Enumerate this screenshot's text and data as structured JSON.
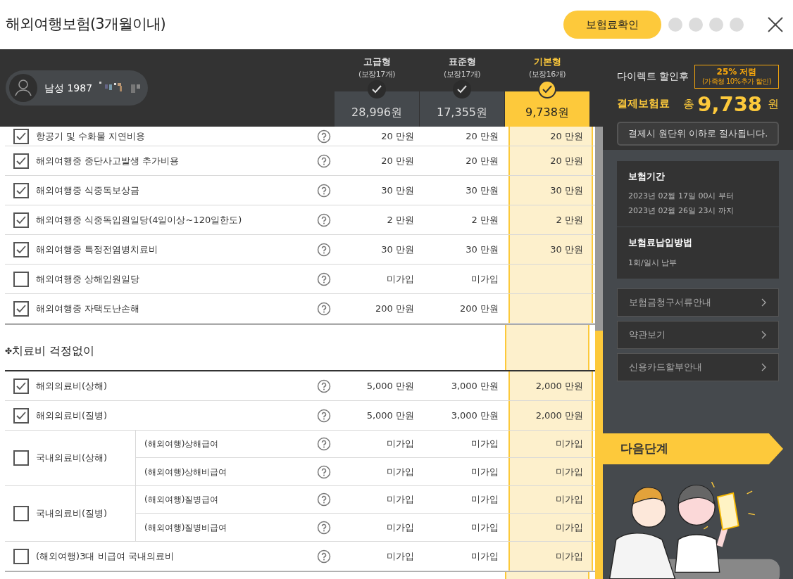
{
  "title": "해외여행보험(3개월이내)",
  "header_button": "보험료확인",
  "step_dots": [
    {
      "selected": false
    },
    {
      "selected": false
    },
    {
      "selected": false
    },
    {
      "selected": false
    }
  ],
  "user": {
    "label": "남성 1987"
  },
  "plans": [
    {
      "name": "고급형",
      "sub": "(보장17개)",
      "price": "28,996원",
      "selected": false
    },
    {
      "name": "표준형",
      "sub": "(보장17개)",
      "price": "17,355원",
      "selected": false
    },
    {
      "name": "기본형",
      "sub": "(보장16개)",
      "price": "9,738원",
      "selected": true
    }
  ],
  "rows_top": [
    {
      "kind": "single",
      "label": "항공기 및 수화물 지연비용",
      "checked": true,
      "values": [
        "20 만원",
        "20 만원",
        "20 만원"
      ]
    },
    {
      "kind": "single",
      "label": "해외여행중 중단사고발생 추가비용",
      "checked": true,
      "values": [
        "20 만원",
        "20 만원",
        "20 만원"
      ]
    },
    {
      "kind": "single",
      "label": "해외여행중 식중독보상금",
      "checked": true,
      "values": [
        "30 만원",
        "30 만원",
        "30 만원"
      ]
    },
    {
      "kind": "single",
      "label": "해외여행중 식중독입원일당(4일이상~120일한도)",
      "checked": true,
      "values": [
        "2 만원",
        "2 만원",
        "2 만원"
      ]
    },
    {
      "kind": "single",
      "label": "해외여행중 특정전염병치료비",
      "checked": true,
      "values": [
        "30 만원",
        "30 만원",
        "30 만원"
      ]
    },
    {
      "kind": "single",
      "label": "해외여행중 상해입원일당",
      "checked": false,
      "values": [
        "미가입",
        "미가입"
      ]
    },
    {
      "kind": "single",
      "label": "해외여행중 자택도난손해",
      "checked": true,
      "values": [
        "200 만원",
        "200 만원"
      ]
    }
  ],
  "section": {
    "marker": "✤",
    "title": "치료비 걱정없이"
  },
  "rows_section": [
    {
      "kind": "single",
      "label": "해외의료비(상해)",
      "checked": true,
      "values": [
        "5,000 만원",
        "3,000 만원",
        "2,000 만원"
      ]
    },
    {
      "kind": "single",
      "label": "해외의료비(질병)",
      "checked": true,
      "values": [
        "5,000 만원",
        "3,000 만원",
        "2,000 만원"
      ]
    },
    {
      "kind": "group",
      "label": "국내의료비(상해)",
      "checked": false,
      "children": [
        {
          "label": "(해외여행)상해급여",
          "values": [
            "미가입",
            "미가입",
            "미가입"
          ]
        },
        {
          "label": "(해외여행)상해비급여",
          "values": [
            "미가입",
            "미가입",
            "미가입"
          ]
        }
      ]
    },
    {
      "kind": "group",
      "label": "국내의료비(질병)",
      "checked": false,
      "children": [
        {
          "label": "(해외여행)질병급여",
          "values": [
            "미가입",
            "미가입",
            "미가입"
          ]
        },
        {
          "label": "(해외여행)질병비급여",
          "values": [
            "미가입",
            "미가입",
            "미가입"
          ]
        }
      ]
    },
    {
      "kind": "single",
      "label": "(해외여행)3대 비급여 국내의료비",
      "checked": false,
      "values": [
        "미가입",
        "미가입",
        "미가입"
      ]
    }
  ],
  "summary": {
    "discount_label": "다이렉트 할인후",
    "badge_main": "25% 저렴",
    "badge_sub": "(가족형 10%추가 할인)",
    "total_label": "결제보험료",
    "total_prefix": "총",
    "total_amount": "9,738",
    "total_unit": "원",
    "tooltip": "결제시 원단위 이하로 절사됩니다."
  },
  "info": [
    {
      "title": "보험기간",
      "lines": [
        "2023년 02월 17일 00시 부터",
        "2023년 02월 26일 23시 까지"
      ]
    },
    {
      "title": "보험료납입방법",
      "lines": [
        "1회/일시 납부"
      ]
    }
  ],
  "links": [
    "보험금청구서류안내",
    "약관보기",
    "신용카드할부안내"
  ],
  "next_button": "다음단계"
}
